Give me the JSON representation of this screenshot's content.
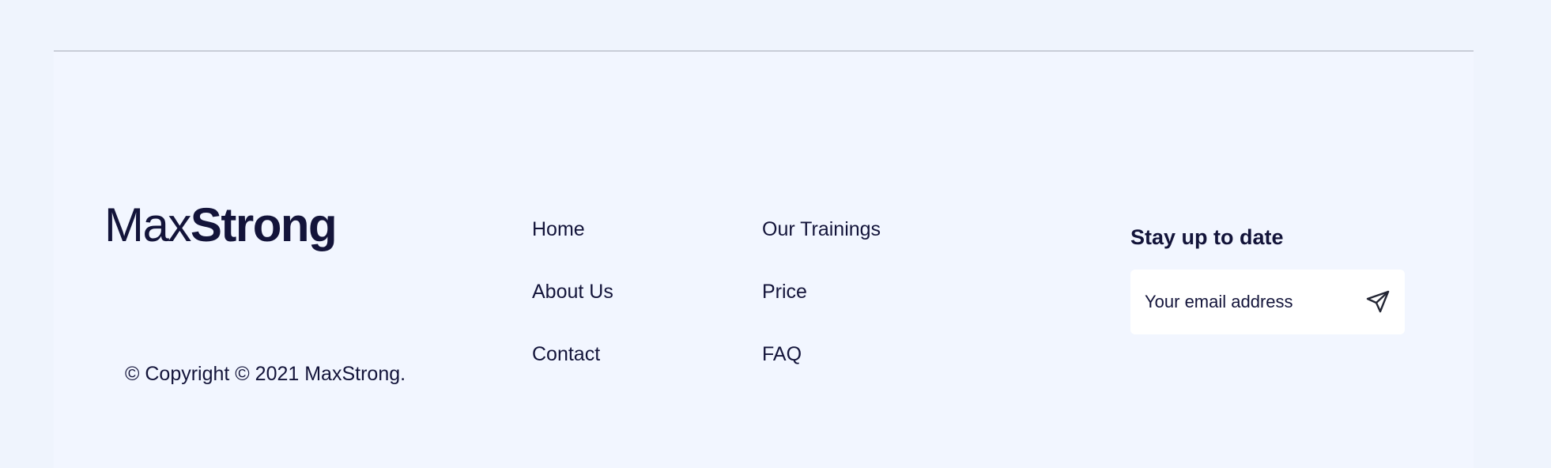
{
  "brand": {
    "logo_light": "Max",
    "logo_bold": "Strong"
  },
  "copyright": "© Copyright © 2021 MaxStrong.",
  "nav": {
    "column1": [
      "Home",
      "About Us",
      "Contact"
    ],
    "column2": [
      "Our Trainings",
      "Price",
      "FAQ"
    ]
  },
  "subscribe": {
    "title": "Stay up to date",
    "placeholder": "Your email address",
    "icon": "send-icon"
  },
  "colors": {
    "background": "#eff4fd",
    "footer_background": "#f2f6ff",
    "text": "#13143a",
    "divider": "#a9adb8",
    "input_background": "#ffffff"
  }
}
